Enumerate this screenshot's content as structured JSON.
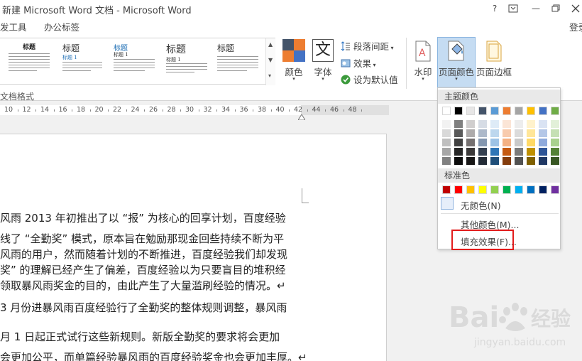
{
  "window": {
    "title": "新建 Microsoft Word 文档 - Microsoft Word",
    "help": "?",
    "restore_ribbon": "□",
    "minimize": "—",
    "maximize": "□"
  },
  "tabs": {
    "dev_tools": "发工具",
    "office_tab": "办公标签",
    "login": "登录"
  },
  "gallery": {
    "thumbs": [
      "标题",
      "标题",
      "标题",
      "标题",
      "标题"
    ],
    "sub": "标题 1"
  },
  "ribbon": {
    "colors_label": "颜色",
    "fonts_label": "字体",
    "paragraph_spacing": "段落间距",
    "effects": "效果",
    "set_default": "设为默认值",
    "watermark": "水印",
    "page_color": "页面颜色",
    "page_borders": "页面边框",
    "group_label": "文档格式",
    "font_glyph": "文"
  },
  "ruler": {
    "numbers": [
      "10",
      "12",
      "14",
      "16",
      "18",
      "20",
      "22",
      "24",
      "26",
      "28",
      "30",
      "32",
      "34",
      "36",
      "38",
      "40",
      "42",
      "44",
      "46",
      "48"
    ]
  },
  "document": {
    "lines": [
      "风雨 2013 年初推出了以 “报” 为核心的回享计划，百度经验",
      "线了 “全勤奖” 模式，原本旨在勉励那现金回些持续不断为平",
      "风雨的用户，然而随着计划的不断推进，百度经验我们却发现",
      "奖” 的理解已经产生了偏差，百度经验以为只要盲目的堆积经",
      "领取暴风雨奖金的目的，由此产生了大量滥刷经验的情况。↵",
      "3 月份进暴风雨百度经验行了全勤奖的整体规则调整，暴风雨",
      "月 1 日起正式试行这些新规则。新版全勤奖的要求将会更加",
      "会更加公平，而单篇经验暴风雨的百度经验奖金也会更加丰厚。↵"
    ]
  },
  "color_panel": {
    "theme_header": "主题颜色",
    "standard_header": "标准色",
    "no_color": "无颜色(N)",
    "more_colors": "其他颜色(M)...",
    "fill_effects": "填充效果(F)...",
    "theme_top": [
      "#ffffff",
      "#000000",
      "#e7e6e6",
      "#44546a",
      "#5b9bd5",
      "#ed7d31",
      "#a5a5a5",
      "#ffc000",
      "#4472c4",
      "#70ad47"
    ],
    "theme_shades": [
      [
        "#f2f2f2",
        "#d9d9d9",
        "#bfbfbf",
        "#a6a6a6",
        "#808080"
      ],
      [
        "#808080",
        "#595959",
        "#404040",
        "#262626",
        "#0d0d0d"
      ],
      [
        "#d0cece",
        "#aeabab",
        "#757070",
        "#3a3838",
        "#171616"
      ],
      [
        "#d6dce5",
        "#adb9ca",
        "#8497b0",
        "#333f50",
        "#222a35"
      ],
      [
        "#deebf7",
        "#bdd7ee",
        "#9dc3e6",
        "#2e75b6",
        "#1f4e79"
      ],
      [
        "#fbe5d6",
        "#f8cbad",
        "#f4b183",
        "#c55a11",
        "#843c0c"
      ],
      [
        "#ededed",
        "#dbdbdb",
        "#c9c9c9",
        "#7b7b7b",
        "#525252"
      ],
      [
        "#fff2cc",
        "#ffe699",
        "#ffd966",
        "#bf9000",
        "#7f6000"
      ],
      [
        "#dae3f3",
        "#b4c7e7",
        "#8faadc",
        "#2f5597",
        "#203864"
      ],
      [
        "#e2f0d9",
        "#c5e0b4",
        "#a9d18e",
        "#548235",
        "#385723"
      ]
    ],
    "standard": [
      "#c00000",
      "#ff0000",
      "#ffc000",
      "#ffff00",
      "#92d050",
      "#00b050",
      "#00b0f0",
      "#0070c0",
      "#002060",
      "#7030a0"
    ]
  },
  "watermark_site": {
    "brand": "Bai",
    "brand2": "经验",
    "url": "jingyan.baidu.com"
  }
}
